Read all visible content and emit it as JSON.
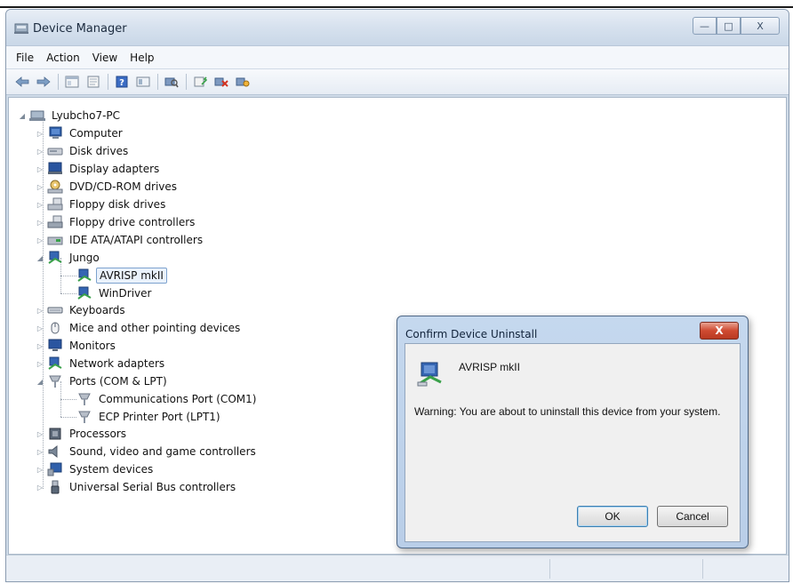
{
  "window": {
    "title": "Device Manager",
    "controls": {
      "minimize": "—",
      "maximize": "□",
      "close": "X"
    }
  },
  "menu": [
    "File",
    "Action",
    "View",
    "Help"
  ],
  "toolbar": {
    "icons": [
      "back-icon",
      "forward-icon",
      "show-hide-console-tree-icon",
      "properties-icon",
      "help-icon",
      "view-icon",
      "scan-hardware-icon",
      "update-driver-icon",
      "uninstall-icon",
      "disable-icon"
    ]
  },
  "tree": {
    "root": "Lyubcho7-PC",
    "items": [
      {
        "label": "Computer",
        "icon": "computer-icon",
        "expander": "▷"
      },
      {
        "label": "Disk drives",
        "icon": "disk-drive-icon",
        "expander": "▷"
      },
      {
        "label": "Display adapters",
        "icon": "display-adapter-icon",
        "expander": "▷"
      },
      {
        "label": "DVD/CD-ROM drives",
        "icon": "dvd-drive-icon",
        "expander": "▷"
      },
      {
        "label": "Floppy disk drives",
        "icon": "floppy-drive-icon",
        "expander": "▷"
      },
      {
        "label": "Floppy drive controllers",
        "icon": "floppy-controller-icon",
        "expander": "▷"
      },
      {
        "label": "IDE ATA/ATAPI controllers",
        "icon": "ide-controller-icon",
        "expander": "▷"
      },
      {
        "label": "Jungo",
        "icon": "jungo-icon",
        "expander": "◢"
      },
      {
        "label": "Keyboards",
        "icon": "keyboard-icon",
        "expander": "▷"
      },
      {
        "label": "Mice and other pointing devices",
        "icon": "mouse-icon",
        "expander": "▷"
      },
      {
        "label": "Monitors",
        "icon": "monitor-icon",
        "expander": "▷"
      },
      {
        "label": "Network adapters",
        "icon": "network-adapter-icon",
        "expander": "▷"
      },
      {
        "label": "Ports (COM & LPT)",
        "icon": "port-icon",
        "expander": "◢"
      },
      {
        "label": "Processors",
        "icon": "processor-icon",
        "expander": "▷"
      },
      {
        "label": "Sound, video and game controllers",
        "icon": "sound-icon",
        "expander": "▷"
      },
      {
        "label": "System devices",
        "icon": "system-device-icon",
        "expander": "▷"
      },
      {
        "label": "Universal Serial Bus controllers",
        "icon": "usb-icon",
        "expander": "▷"
      }
    ],
    "jungo_children": [
      "AVRISP mkII",
      "WinDriver"
    ],
    "ports_children": [
      "Communications Port (COM1)",
      "ECP Printer Port (LPT1)"
    ],
    "selected": "AVRISP mkII"
  },
  "dialog": {
    "title": "Confirm Device Uninstall",
    "close_label": "X",
    "device_name": "AVRISP mkII",
    "warning": "Warning: You are about to uninstall this device from your system.",
    "ok_label": "OK",
    "cancel_label": "Cancel"
  },
  "colors": {
    "titlebar": "#d6e1ee",
    "selection": "#eaf2fc",
    "close_red": "#cf4a31"
  }
}
